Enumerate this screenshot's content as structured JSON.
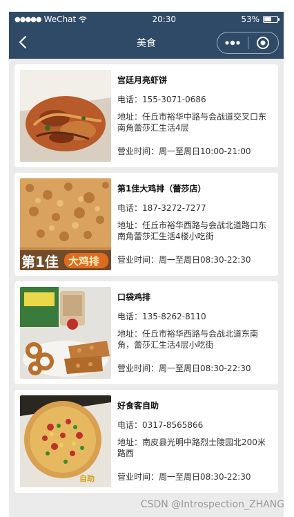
{
  "statusbar": {
    "carrier": "WeChat",
    "time": "20:30",
    "battery": "53%",
    "battery_level": 0.53
  },
  "navbar": {
    "title": "美食"
  },
  "restaurants": [
    {
      "name": "宫廷月亮虾饼",
      "phone": "电话：155-3071-0686",
      "address": "地址：任丘市裕华中路与会战道交叉口东南角蕾莎汇生活4层",
      "hours": "营业时间：周一至周日10:00-21:00"
    },
    {
      "name": "第1佳大鸡排（蕾莎店）",
      "phone": "电话：187-3272-7277",
      "address": "地址：任丘市裕华西路与会战北道路口东南角蕾莎汇生活4楼小吃街",
      "hours": "营业时间：周一至周日08:30-22:30"
    },
    {
      "name": "口袋鸡排",
      "phone": "电话：135-8262-8110",
      "address": "地址：任丘市裕华西路与会战北道东南角，蕾莎汇生活4层小吃街",
      "hours": "营业时间：周一至周日08:30-22:30"
    },
    {
      "name": "好食客自助",
      "phone": "电话：0317-8565866",
      "address": "地址：南皮县光明中路烈士陵园北200米路西",
      "hours": "营业时间：周一至周日08:30-22:30"
    }
  ],
  "watermark": "CSDN @Introspection_ZHANG",
  "colors": {
    "navbar": "#2f4a66",
    "background": "#ebebeb"
  }
}
